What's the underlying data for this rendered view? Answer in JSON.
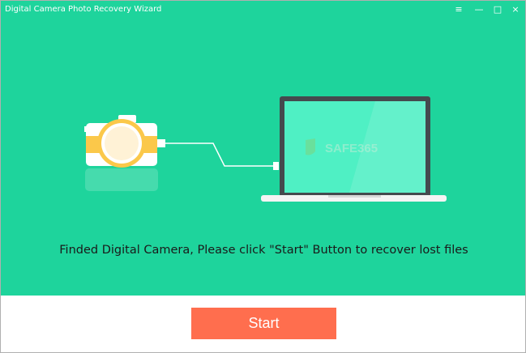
{
  "window": {
    "title": "Digital Camera Photo Recovery Wizard",
    "controls": {
      "menu": "≡",
      "minimize": "—",
      "maximize": "□",
      "close": "×"
    }
  },
  "main": {
    "watermark": "SAFE365",
    "message": "Finded Digital Camera, Please click \"Start\" Button to recover lost files"
  },
  "footer": {
    "start_label": "Start"
  },
  "colors": {
    "background": "#1ed49c",
    "screen": "#4ff0c4",
    "camera_accent": "#fbc84a",
    "start_button": "#ff6e4e"
  },
  "icons": [
    "menu-icon",
    "minimize-icon",
    "maximize-icon",
    "close-icon",
    "camera-icon",
    "laptop-icon"
  ]
}
